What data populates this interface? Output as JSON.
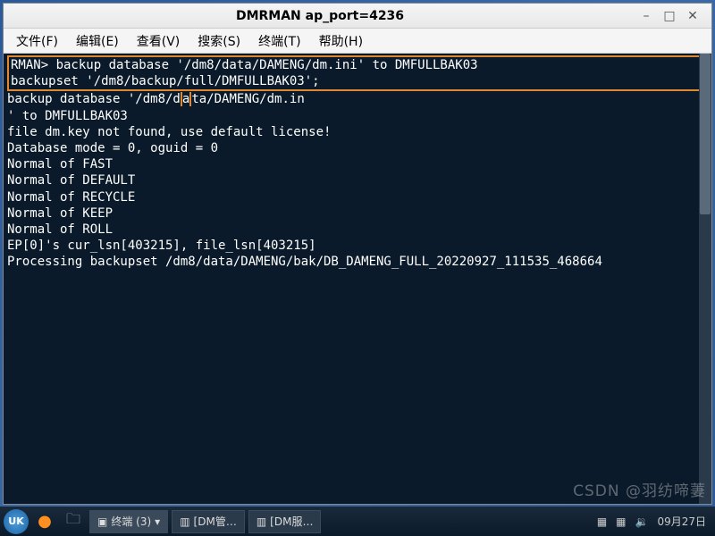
{
  "window": {
    "title": "DMRMAN ap_port=4236"
  },
  "menubar": {
    "file": "文件(F)",
    "edit": "编辑(E)",
    "view": "查看(V)",
    "search": "搜索(S)",
    "terminal": "终端(T)",
    "help": "帮助(H)"
  },
  "terminal": {
    "hl1": "RMAN> backup database '/dm8/data/DAMENG/dm.ini' to DMFULLBAK03",
    "hl2_a": "backupset '/dm8/backup/full/DMFULLBAK03';",
    "hl2_b": "backup database '/dm8/d",
    "hl2_c": "ta/DAMENG/dm.in",
    "l3": "' to DMFULLBAK03",
    "l4": "file dm.key not found, use default license!",
    "l5": "Database mode = 0, oguid = 0",
    "l6": "Normal of FAST",
    "l7": "Normal of DEFAULT",
    "l8": "Normal of RECYCLE",
    "l9": "Normal of KEEP",
    "l10": "Normal of ROLL",
    "l11": "EP[0]'s cur_lsn[403215], file_lsn[403215]",
    "l12": "Processing backupset /dm8/data/DAMENG/bak/DB_DAMENG_FULL_20220927_111535_468664"
  },
  "taskbar": {
    "start": "UK",
    "task1": "终端 (3)",
    "task2": "[DM管…",
    "task3": "[DM服…",
    "watermark": "CSDN @羽纺啼萋",
    "date": "09月27日"
  },
  "icons": {
    "min": "–",
    "max": "□",
    "close": "✕",
    "firefox": "●",
    "folder": "🗀",
    "term": "▣",
    "dm": "▥",
    "sound": "🔉",
    "run": "▦",
    "more": "▾"
  }
}
